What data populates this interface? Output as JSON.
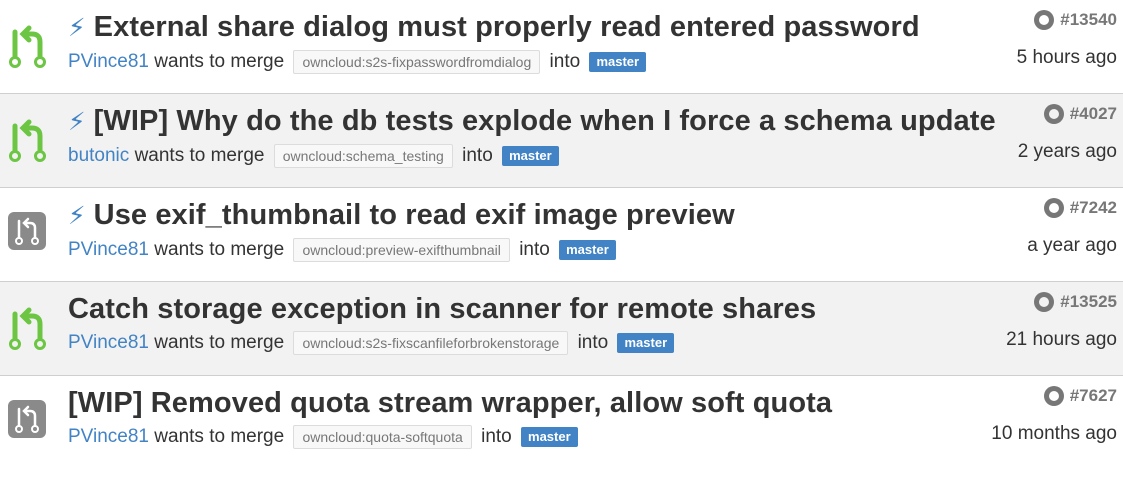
{
  "colors": {
    "open": "#6cc644",
    "closed": "#8a8a8a",
    "link": "#4183c4"
  },
  "icons": {
    "pr_open": "git-pull-request-icon",
    "pr_closed": "git-pull-request-icon",
    "bolt": "lightning-bolt-icon",
    "github": "github-logo-icon"
  },
  "pull_requests": [
    {
      "bolt": "⚡",
      "title": "External share dialog must properly read entered password",
      "author": "PVince81",
      "verb": "wants to merge",
      "head": "owncloud:s2s-fixpasswordfromdialog",
      "into": "into",
      "base": "master",
      "number": "#13540",
      "time": "5 hours ago",
      "state": "open"
    },
    {
      "bolt": "⚡",
      "title": "[WIP] Why do the db tests explode when I force a schema update",
      "author": "butonic",
      "verb": "wants to merge",
      "head": "owncloud:schema_testing",
      "into": "into",
      "base": "master",
      "number": "#4027",
      "time": "2 years ago",
      "state": "open"
    },
    {
      "bolt": "⚡",
      "title": "Use exif_thumbnail to read exif image preview",
      "author": "PVince81",
      "verb": "wants to merge",
      "head": "owncloud:preview-exifthumbnail",
      "into": "into",
      "base": "master",
      "number": "#7242",
      "time": "a year ago",
      "state": "closed"
    },
    {
      "bolt": "",
      "title": "Catch storage exception in scanner for remote shares",
      "author": "PVince81",
      "verb": "wants to merge",
      "head": "owncloud:s2s-fixscanfileforbrokenstorage",
      "into": "into",
      "base": "master",
      "number": "#13525",
      "time": "21 hours ago",
      "state": "open"
    },
    {
      "bolt": "",
      "title": "[WIP] Removed quota stream wrapper, allow soft quota",
      "author": "PVince81",
      "verb": "wants to merge",
      "head": "owncloud:quota-softquota",
      "into": "into",
      "base": "master",
      "number": "#7627",
      "time": "10 months ago",
      "state": "closed"
    }
  ]
}
